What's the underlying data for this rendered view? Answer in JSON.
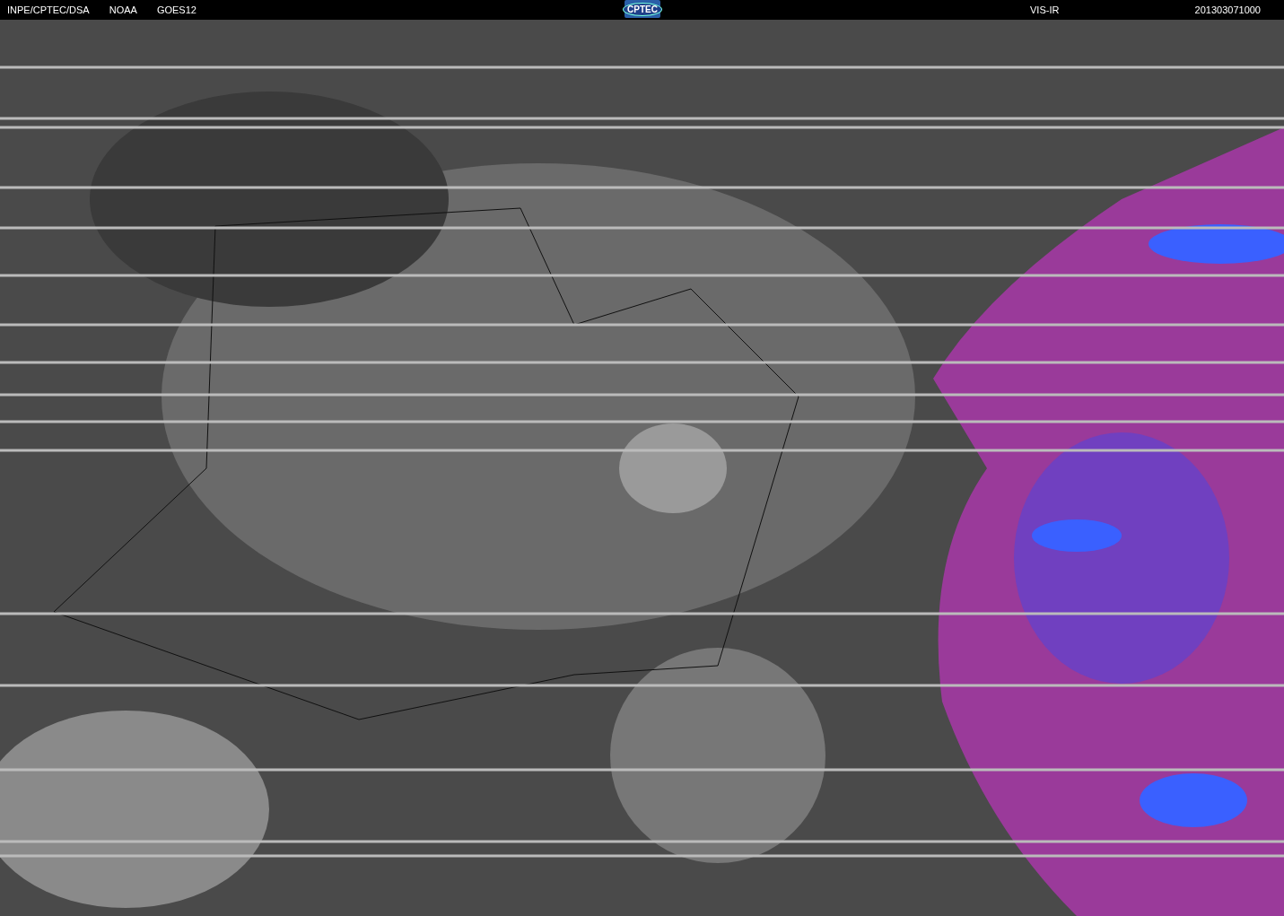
{
  "header": {
    "source": "INPE/CPTEC/DSA",
    "agency": "NOAA",
    "satellite": "GOES12",
    "logo": "CPTEC",
    "channel": "VIS-IR",
    "timestamp": "201303071000"
  }
}
